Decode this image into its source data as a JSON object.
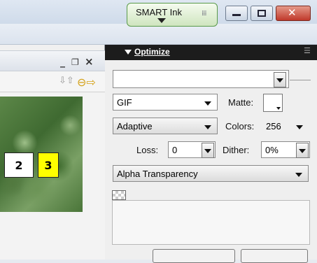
{
  "smart_ink": {
    "label": "SMART Ink",
    "grip": "⁞⁞⁞"
  },
  "window_controls": {
    "close_glyph": "✕"
  },
  "document_window": {
    "minimize_glyph": "_",
    "restore_glyph": "❐",
    "close_glyph": "×",
    "sort_icon": "⇩⇧",
    "export_icon": "⊖⇨",
    "slices": [
      {
        "label": "2",
        "color": "#ffffff"
      },
      {
        "label": "3",
        "color": "#ffff00"
      }
    ]
  },
  "optimize_panel": {
    "title": "Optimize",
    "menu_glyph": "☰",
    "settings_value": "",
    "format_value": "GIF",
    "matte_label": "Matte:",
    "palette_value": "Adaptive",
    "colors_label": "Colors:",
    "colors_value": "256",
    "loss_label": "Loss:",
    "loss_value": "0",
    "dither_label": "Dither:",
    "dither_value": "0%",
    "transparency_value": "Alpha Transparency"
  }
}
